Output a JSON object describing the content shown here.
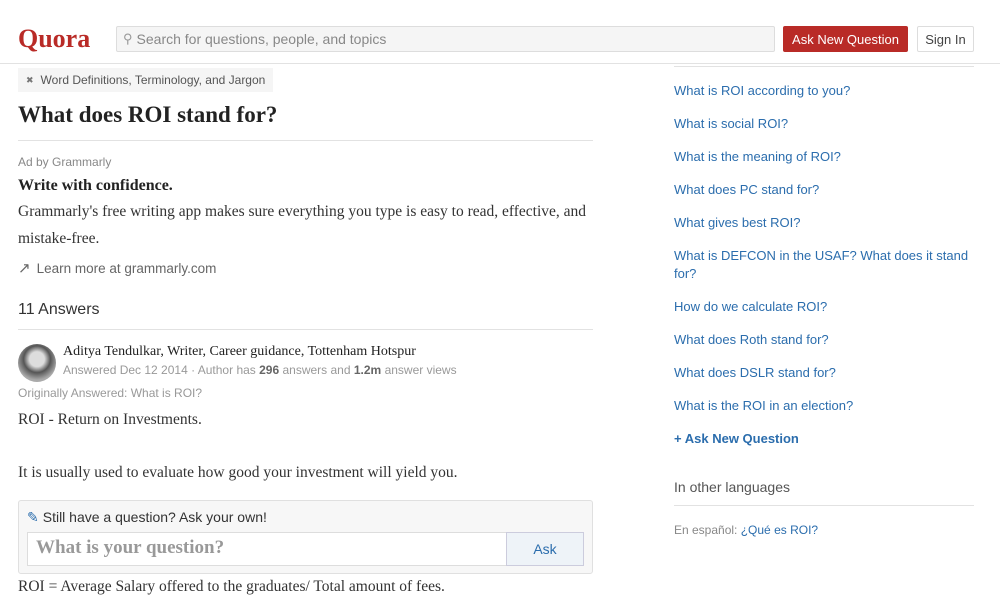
{
  "header": {
    "logo": "Quora",
    "search_placeholder": "Search for questions, people, and topics",
    "ask_label": "Ask New Question",
    "sign_in_label": "Sign In"
  },
  "question": {
    "topic": "Word Definitions, Terminology, and Jargon",
    "title": "What does ROI stand for?"
  },
  "ad": {
    "by": "Ad by Grammarly",
    "title": "Write with confidence.",
    "body": "Grammarly's free writing app makes sure everything you type is easy to read, effective, and mistake-free.",
    "link": "Learn more at grammarly.com"
  },
  "answers": {
    "count": "11 Answers",
    "author": "Aditya Tendulkar, Writer, Career guidance, Tottenham Hotspur",
    "answered": "Answered Dec 12 2014 · Author has ",
    "num_answers": "296",
    "mid": " answers and ",
    "views": "1.2m",
    "tail": " answer views",
    "originally": "Originally Answered: What is ROI?",
    "p1": "ROI - Return on Investments.",
    "p2": "It is usually used to evaluate how good your investment will yield you.",
    "p3": "ROI = Average Salary offered to the graduates/ Total amount of fees."
  },
  "ask_box": {
    "label": "Still have a question? Ask your own!",
    "placeholder": "What is your question?",
    "button": "Ask"
  },
  "sidebar": {
    "related": [
      "What is ROI according to you?",
      "What is social ROI?",
      "What is the meaning of ROI?",
      "What does PC stand for?",
      "What gives best ROI?",
      "What is DEFCON in the USAF? What does it stand for?",
      "How do we calculate ROI?",
      "What does Roth stand for?",
      "What does DSLR stand for?",
      "What is the ROI in an election?"
    ],
    "ask_new": "Ask New Question",
    "other_languages": "In other languages",
    "lang_prefix": "En español: ",
    "lang_link": "¿Qué es ROI?"
  },
  "colors": {
    "brand": "#b92b27",
    "link": "#2b6dad"
  }
}
